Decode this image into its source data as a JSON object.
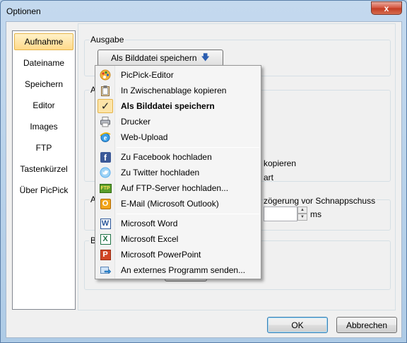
{
  "window": {
    "title": "Optionen",
    "close_glyph": "x"
  },
  "sidebar": {
    "items": [
      {
        "label": "Aufnahme",
        "selected": true
      },
      {
        "label": "Dateiname",
        "selected": false
      },
      {
        "label": "Speichern",
        "selected": false
      },
      {
        "label": "Editor",
        "selected": false
      },
      {
        "label": "Images",
        "selected": false
      },
      {
        "label": "FTP",
        "selected": false
      },
      {
        "label": "Tastenkürzel",
        "selected": false
      },
      {
        "label": "Über PicPick",
        "selected": false
      }
    ]
  },
  "ausgabe": {
    "group_label": "Ausgabe",
    "button_label": "Als Bilddatei speichern",
    "button_arrow": "🡇"
  },
  "background_partial": {
    "group2_label": "A",
    "group3_label": "A",
    "group4_label": "Bi",
    "text_kopieren": "kopieren",
    "text_art": "art",
    "text_delay": "zögerung vor Schnappschuss",
    "unit_ms": "ms"
  },
  "menu": {
    "items": [
      {
        "label": "PicPick-Editor",
        "icon": "picpick-editor-icon",
        "checked": false
      },
      {
        "label": "In Zwischenablage kopieren",
        "icon": "clipboard-icon",
        "checked": false
      },
      {
        "label": "Als Bilddatei speichern",
        "icon": "checkmark-icon",
        "checked": true
      },
      {
        "label": "Drucker",
        "icon": "printer-icon",
        "checked": false
      },
      {
        "label": "Web-Upload",
        "icon": "internet-explorer-icon",
        "checked": false
      },
      {
        "label": "Zu Facebook hochladen",
        "icon": "facebook-icon",
        "checked": false
      },
      {
        "label": "Zu Twitter hochladen",
        "icon": "twitter-icon",
        "checked": false
      },
      {
        "label": "Auf FTP-Server hochladen...",
        "icon": "ftp-icon",
        "checked": false
      },
      {
        "label": "E-Mail (Microsoft Outlook)",
        "icon": "outlook-icon",
        "checked": false
      },
      {
        "label": "Microsoft Word",
        "icon": "word-icon",
        "checked": false
      },
      {
        "label": "Microsoft Excel",
        "icon": "excel-icon",
        "checked": false
      },
      {
        "label": "Microsoft PowerPoint",
        "icon": "powerpoint-icon",
        "checked": false
      },
      {
        "label": "An externes Programm senden...",
        "icon": "external-program-icon",
        "checked": false
      }
    ],
    "check_glyph": "✓",
    "ftp_icon_text": "FTP",
    "facebook_icon_text": "f",
    "word_icon_text": "W",
    "excel_icon_text": "X",
    "powerpoint_icon_text": "P",
    "outlook_icon_text": "O"
  },
  "footer": {
    "ok_label": "OK",
    "cancel_label": "Abbrechen"
  },
  "colors": {
    "selection": "#ffd98a",
    "close": "#c23b22",
    "accent": "#2a5db0"
  }
}
